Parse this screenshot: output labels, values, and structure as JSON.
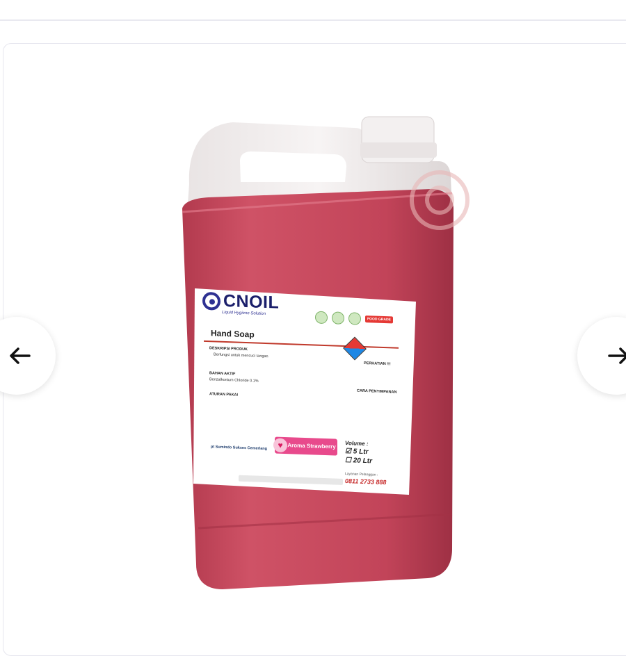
{
  "gallery": {
    "prev_icon": "arrow-left-icon",
    "next_icon": "arrow-right-icon"
  },
  "product_label": {
    "brand": "CNOIL",
    "tagline": "Liquid Hygiene Solution",
    "food_grade": "FOOD GRADE",
    "product_name": "Hand Soap",
    "description_title": "DESKRIPSI PRODUK",
    "description_text": "Berfungsi untuk mencuci tangan",
    "ingredients_title": "BAHAN AKTIF",
    "ingredients_text": "Benzalkonium Chloride 0.1%",
    "usage_title": "ATURAN PAKAI",
    "warning_title": "PERHATIAN !!!",
    "storage_title": "CARA PENYIMPANAN",
    "aroma_label": "Aroma Strawberry",
    "volume_title": "Volume :",
    "volume_options": [
      "5 Ltr",
      "20 Ltr"
    ],
    "manufacturer": "pt Sumindo Sukses Cemerlang",
    "service_label": "Layanan Pelanggan :",
    "phone": "0811 2733 888"
  },
  "colors": {
    "liquid": "#c94a5e",
    "cap": "#f2eeee",
    "brand_blue": "#2e3192",
    "aroma_pink": "#e84a8c"
  }
}
